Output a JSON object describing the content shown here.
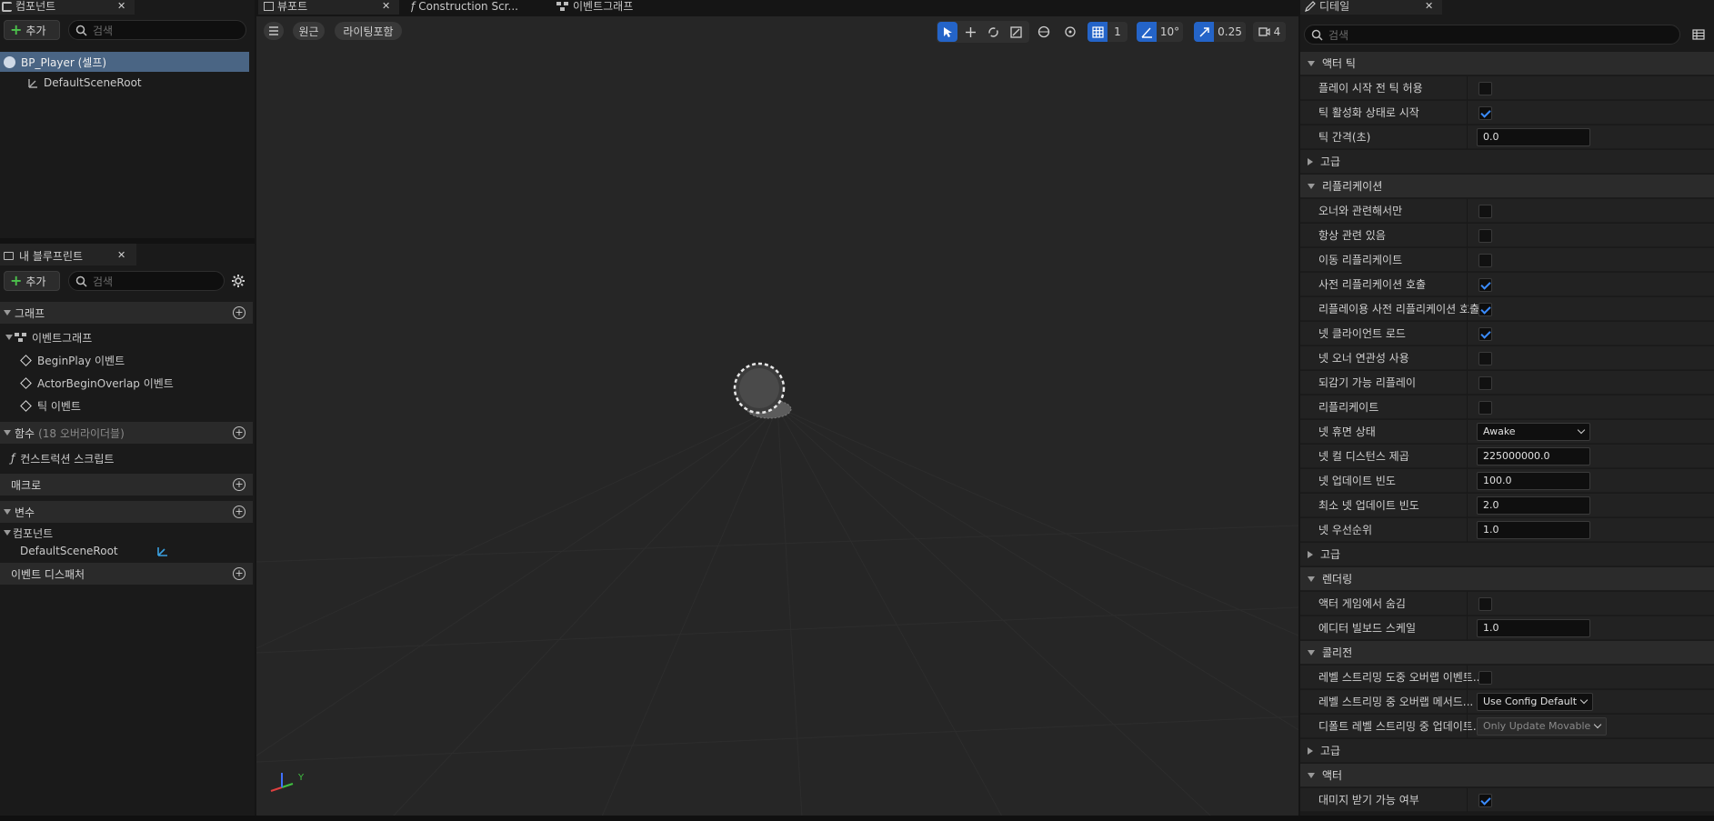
{
  "components": {
    "tab_title": "컴포넌트",
    "add_label": "추가",
    "search_placeholder": "검색",
    "root_item": "BP_Player (셀프)",
    "child_item": "DefaultSceneRoot"
  },
  "blueprint": {
    "tab_title": "내 블루프린트",
    "add_label": "추가",
    "search_placeholder": "검색",
    "graphs_label": "그래프",
    "event_graph": "이벤트그래프",
    "events": [
      "BeginPlay 이벤트",
      "ActorBeginOverlap 이벤트",
      "틱 이벤트"
    ],
    "functions_label": "함수",
    "functions_note": "(18 오버라이더블)",
    "construction_script": "컨스트럭션 스크립트",
    "macros_label": "매크로",
    "variables_label": "변수",
    "components_category": "컴포넌트",
    "variable_item": "DefaultSceneRoot",
    "dispatchers_label": "이벤트 디스패처"
  },
  "viewport": {
    "tabs": [
      "뷰포트",
      "Construction Scr...",
      "이벤트그래프"
    ],
    "perspective_label": "원근",
    "lit_label": "라이팅포함",
    "grid_value": "1",
    "angle_value": "10°",
    "scale_value": "0.25",
    "camera_value": "4",
    "axis_y": "Y"
  },
  "details": {
    "tab_title": "디테일",
    "search_placeholder": "검색",
    "sections": [
      {
        "type": "section",
        "label": "액터 틱"
      },
      {
        "type": "check",
        "label": "플레이 시작 전 틱 허용",
        "checked": false
      },
      {
        "type": "check",
        "label": "틱 활성화 상태로 시작",
        "checked": true
      },
      {
        "type": "number",
        "label": "틱 간격(초)",
        "value": "0.0"
      },
      {
        "type": "sub",
        "label": "고급"
      },
      {
        "type": "section",
        "label": "리플리케이션"
      },
      {
        "type": "check",
        "label": "오너와 관련해서만",
        "checked": false
      },
      {
        "type": "check",
        "label": "항상 관련 있음",
        "checked": false
      },
      {
        "type": "check",
        "label": "이동 리플리케이트",
        "checked": false
      },
      {
        "type": "check",
        "label": "사전 리플리케이션 호출",
        "checked": true
      },
      {
        "type": "check",
        "label": "리플레이용 사전 리플리케이션 호출",
        "checked": true
      },
      {
        "type": "check",
        "label": "넷 클라이언트 로드",
        "checked": true
      },
      {
        "type": "check",
        "label": "넷 오너 연관성 사용",
        "checked": false
      },
      {
        "type": "check",
        "label": "되감기 가능 리플레이",
        "checked": false
      },
      {
        "type": "check",
        "label": "리플리케이트",
        "checked": false
      },
      {
        "type": "dropdown",
        "label": "넷 휴면 상태",
        "value": "Awake"
      },
      {
        "type": "number",
        "label": "넷 컬 디스턴스 제곱",
        "value": "225000000.0"
      },
      {
        "type": "number",
        "label": "넷 업데이트 빈도",
        "value": "100.0"
      },
      {
        "type": "number",
        "label": "최소 넷 업데이트 빈도",
        "value": "2.0"
      },
      {
        "type": "number",
        "label": "넷 우선순위",
        "value": "1.0"
      },
      {
        "type": "sub",
        "label": "고급"
      },
      {
        "type": "section",
        "label": "렌더링"
      },
      {
        "type": "check",
        "label": "액터 게임에서 숨김",
        "checked": false
      },
      {
        "type": "number",
        "label": "에디터 빌보드 스케일",
        "value": "1.0"
      },
      {
        "type": "section",
        "label": "콜리전"
      },
      {
        "type": "check",
        "label": "레벨 스트리밍 도중 오버랩 이벤트...",
        "checked": false
      },
      {
        "type": "dropdown",
        "label": "레벨 스트리밍 중 오버랩 메서드...",
        "value": "Use Config Default"
      },
      {
        "type": "dropdown_disabled",
        "label": "디폴트 레벨 스트리밍 중 업데이트...",
        "value": "Only Update Movable"
      },
      {
        "type": "sub",
        "label": "고급"
      },
      {
        "type": "section",
        "label": "액터"
      },
      {
        "type": "check",
        "label": "대미지 받기 가능 여부",
        "checked": true
      }
    ]
  }
}
